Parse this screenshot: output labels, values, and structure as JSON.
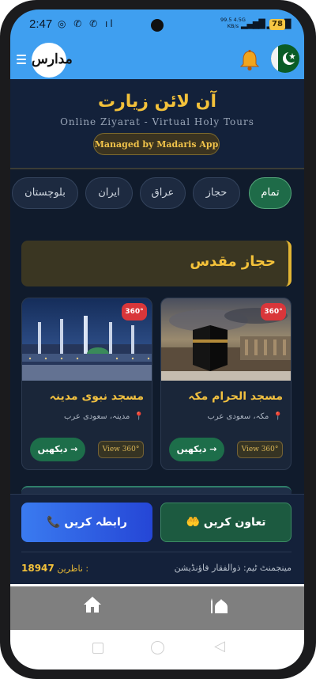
{
  "status_bar": {
    "time": "2:47",
    "icons": "◎ ✆ ✆ ıl",
    "network_speed": "99.5 4.5G",
    "network_unit": "KB/s",
    "battery": "78"
  },
  "app_bar": {
    "logo_text": "مدارس"
  },
  "hero": {
    "title": "آن لائن زیارت",
    "subtitle": "Online Ziyarat - Virtual Holy Tours",
    "managed_by": "Managed by Madaris App"
  },
  "tabs": [
    "تمام",
    "حجاز",
    "عراق",
    "ایران",
    "بلوچستان"
  ],
  "section_title": "حجاز مقدس",
  "cards": [
    {
      "title": "مسجد الحرام مکہ",
      "location": "مکہ، سعودی عرب",
      "badge": "360°",
      "view_360_label": "View 360°",
      "see_label": "دیکھیں →"
    },
    {
      "title": "مسجد نبوی مدینہ",
      "location": "مدینہ، سعودی عرب",
      "badge": "360°",
      "view_360_label": "View 360°",
      "see_label": "دیکھیں →"
    }
  ],
  "footer": {
    "contact_label": "رابطہ کریں",
    "cooperate_label": "تعاون کریں",
    "visits_label": "ناظرین :",
    "visits_count": "18947",
    "management": "مینجمنٹ ٹیم: ذوالفقار فاؤنڈیشن"
  },
  "colors": {
    "app_bar": "#3f9ff0",
    "gold": "#f3c13a",
    "active_tab": "#1e6b48",
    "contact_button": "#2e5fe3",
    "badge_red": "#d9363a"
  }
}
